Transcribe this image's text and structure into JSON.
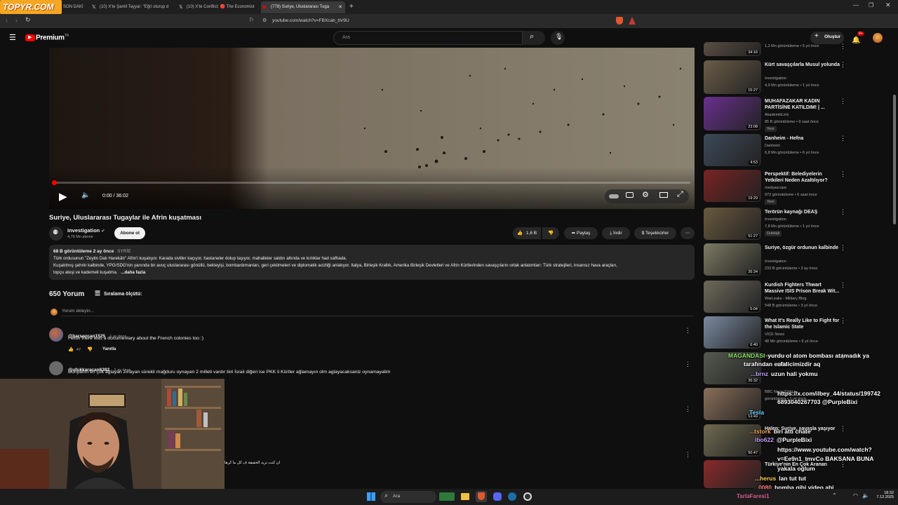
{
  "browser": {
    "logo": "TOPYR.COM",
    "tabs": [
      {
        "label": "SON DAKİ"
      },
      {
        "label": "(10) X'te Şamil Tayyar: \"Eğri oturup d"
      },
      {
        "label": "(10) X'te Conflict: 🔴 The Economist"
      },
      {
        "label": "(778) Suriye, Uluslararası Tuga"
      }
    ],
    "url": "youtube.com/watch?v=FBXcab_bV9U"
  },
  "yt": {
    "logo": "Premium",
    "logo_sup": "TR",
    "search_placeholder": "Ara",
    "create_label": "Oluştur",
    "notif_count": "9+"
  },
  "video": {
    "time": "0:00 / 36:02",
    "title": "Suriye, Uluslararası Tugaylar ile Afrin kuşatması",
    "channel": "Investigation",
    "subs": "4,79 Mn abone",
    "subscribe": "Abone ol",
    "likes": "1,6 B",
    "share": "Paylaş",
    "download": "İndir",
    "thanks": "Teşekkürler",
    "desc_meta": "68 B görüntüleme  2 ay önce",
    "desc_tag": "SYRİE",
    "desc_line1": "Türk ordusunun \"Zeytin Dalı Harekâtı\" Afrin'i kuşatıyor. Karada siviller kaçıyor, hastaneler dolup taşıyor, mahalleler saldırı altında ve kırlıklar had safhada.",
    "desc_line2": "Kuşatılmış şehrin kalbinde, YPG/SDG'nin yanında bir avuç uluslararası gönüllü, bekleyişi, bombardımanları, geri çekilmeleri ve diplomatik acizliği anlatıyor. İtalya, Birleşik Krallık, Amerika Birleşik Devletleri ve Afrin Kürtlerinden savaşçıların ortak anlatımları: Türk stratejileri, insansız hava araçları,",
    "desc_line3": "topçu ateşi ve kademeli kuşatma.",
    "desc_more": "...daha fazla"
  },
  "comments": {
    "count": "650 Yorum",
    "sort": "Sıralama ölçütü:",
    "add_placeholder": "Yorum ekleyin...",
    "items": [
      {
        "user": "@barsozcan1525",
        "time": "1 ay önce",
        "text": "I wish there was a documentary about the French colonies too  :)",
        "likes": "47",
        "reply": "Yanıtla"
      },
      {
        "user": "@ufukkaracan6382",
        "time": "1 ay önce",
        "text": "Dünyanın en çok ağlayan zırlayan sürekli mağduru oynayan 2 milleti vardır biri İsrail diğeri ise PKK li Kürtler ağlamayın olm aglayacaksaniz oynamayalim"
      }
    ],
    "arabic": "ان كنت تريد الحقيقة ف كل ما كرها"
  },
  "sidebar": [
    {
      "title": "",
      "channel": "",
      "meta": "1,2 Mn görüntüleme • 5 yıl önce",
      "dur": "34:16",
      "color": "#5a4f43"
    },
    {
      "title": "Kürt savaşçılarla Musul yolunda",
      "channel": "Investigation",
      "meta": "4,9 Mn görüntüleme • 1 yıl önce",
      "dur": "15:27",
      "color": "#6b5d48"
    },
    {
      "title": "MUHAFAZAKAR KADIN PARTİSİNE KATILDIM! | ...",
      "channel": "AkademikLink",
      "meta": "85 B görüntüleme • 9 saat önce",
      "badge": "Yeni",
      "dur": "23:08",
      "color": "#6a2f8f"
    },
    {
      "title": "Danheim - Hefna",
      "channel": "Danheim",
      "meta": "6,8 Mn görüntüleme • 6 yıl önce",
      "dur": "4:53",
      "color": "#3d4a58"
    },
    {
      "title": "Perspektif: Belediyelerin Yetkileri Neden Azaltılıyor?",
      "channel": "medyascope",
      "meta": "972 görüntüleme • 6 saat önce",
      "badge": "Yeni",
      "dur": "19:29",
      "color": "#7a2323"
    },
    {
      "title": "Terörün kaynağı DEAŞ",
      "channel": "Investigation",
      "meta": "7,8 Mn görüntüleme • 1 yıl önce",
      "badge": "Dublajlı",
      "dur": "51:27",
      "color": "#6a5a3f"
    },
    {
      "title": "Suriye, özgür ordunun kalbinde",
      "channel": "Investigation",
      "meta": "233 B görüntüleme • 3 ay önce",
      "dur": "26:34",
      "color": "#7d7a62"
    },
    {
      "title": "Kurdish Fighters Thwart Massive ISIS Prison Break Wit...",
      "channel": "WarLeaks - Military Blog",
      "meta": "548 B görüntüleme • 3 yıl önce",
      "dur": "5:04",
      "color": "#6e6a5a"
    },
    {
      "title": "What It's Really Like to Fight for the Islamic State",
      "channel": "VICE News",
      "meta": "48 Mn görüntüleme • 9 yıl önce",
      "dur": "6:40",
      "color": "#7b8aa1"
    },
    {
      "title": "",
      "channel": "Investigation",
      "meta": "",
      "dur": "26:32",
      "color": "#555a4e"
    },
    {
      "title": "",
      "channel": "BBC News Türkçe",
      "meta": "görüntüleme • 1 yıl önce",
      "dur": "13:49",
      "color": "#8a6f5a"
    },
    {
      "title": "Halep: Suriye, savaşla yaşıyor",
      "channel": "",
      "meta": "",
      "dur": "50:47",
      "color": "#6f6a50"
    },
    {
      "title": "Türkiye'nin En Çok Aranan",
      "channel": "",
      "meta": "",
      "dur": "",
      "color": "#8a2a2a"
    }
  ],
  "chat": [
    {
      "user": "MAGANDASI",
      "text": "yurdu ol atom bombası atamadık ya",
      "user_color": "#8ee06a"
    },
    {
      "user": "",
      "text": "tarafından ezildi",
      "user_color": "#ffffff"
    },
    {
      "user": "",
      "text": "ulalicimizdir aq",
      "user_color": "#ffffff"
    },
    {
      "user": "...brnz",
      "text": "uzun hali yokmu",
      "user_color": "#c9a0ff"
    },
    {
      "user": "",
      "text": "https://x.com/ilbey_44/status/199742",
      "user_color": "#ffffff"
    },
    {
      "user": "",
      "text": "6893040267703 @PurpleBixi",
      "user_color": "#ffffff"
    },
    {
      "user": "Tesla",
      "text": "",
      "user_color": "#6ad0ff"
    },
    {
      "user": "...tstork",
      "text": "biri atti chate",
      "user_color": "#ffa35c"
    },
    {
      "user": "ibo622",
      "text": "@PurpleBixi",
      "user_color": "#c9a0ff"
    },
    {
      "user": "",
      "text": "https://www.youtube.com/watch?",
      "user_color": "#ffffff"
    },
    {
      "user": "",
      "text": "v=Ee9n1_tmvCo BAKSANA BUNA",
      "user_color": "#ffffff"
    },
    {
      "user": "",
      "text": "yakala oğlum",
      "user_color": "#ffffff"
    },
    {
      "user": "...herus",
      "text": "lan tut tut",
      "user_color": "#ffd25c"
    },
    {
      "user": "...0080",
      "text": "bomba gibi video abi",
      "user_color": "#ff8080"
    }
  ],
  "taskbar": {
    "search": "Ara",
    "streamer": "TarlaFaresi1",
    "time": "18:32",
    "date": "7.12.2025"
  }
}
